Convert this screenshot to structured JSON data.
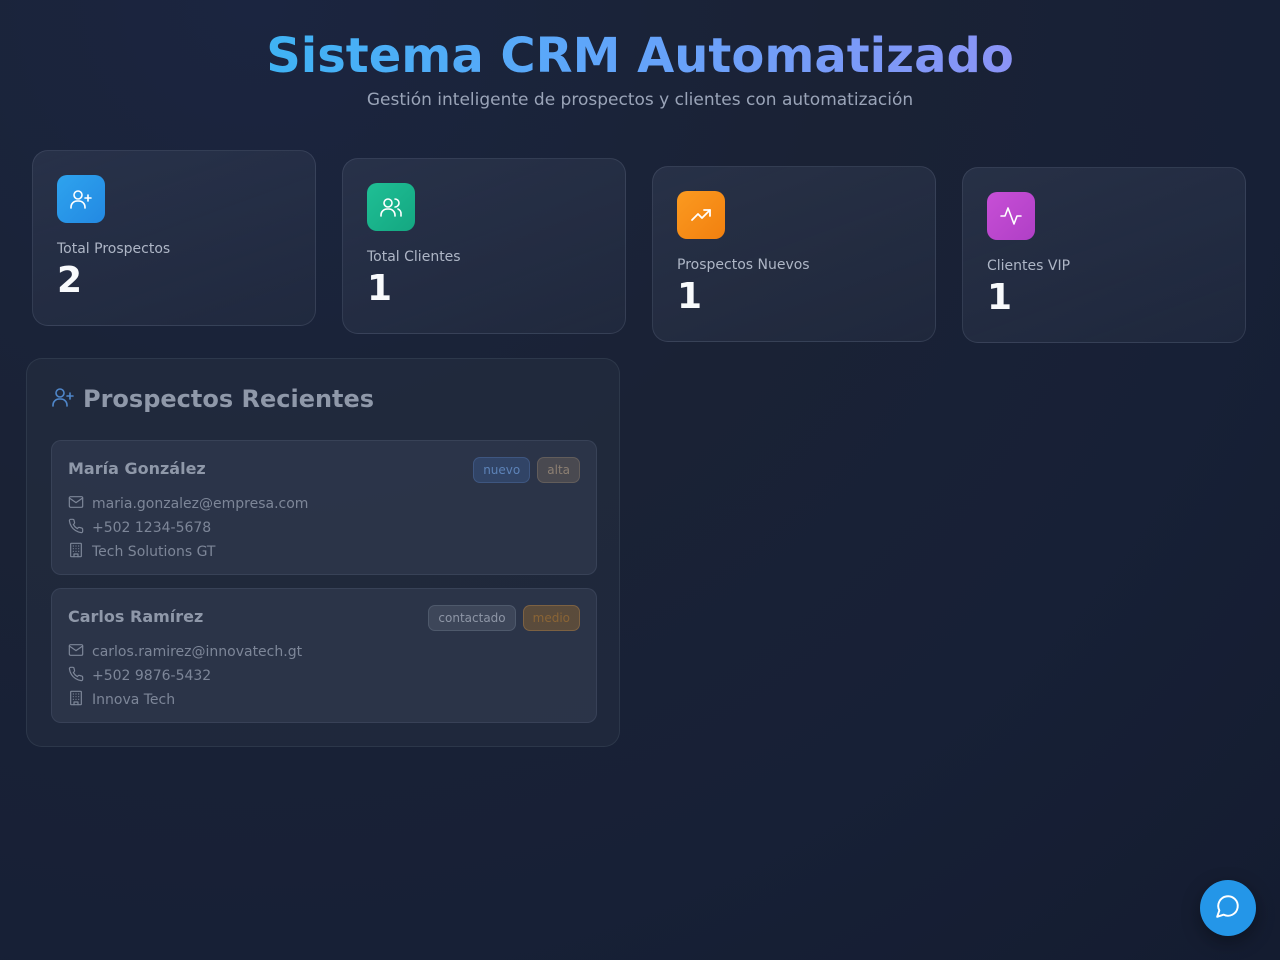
{
  "header": {
    "title": "Sistema CRM Automatizado",
    "subtitle": "Gestión inteligente de prospectos y clientes con automatización"
  },
  "stats": [
    {
      "label": "Total Prospectos",
      "value": "2",
      "icon": "user-plus-icon",
      "color": "#2b9de9"
    },
    {
      "label": "Total Clientes",
      "value": "1",
      "icon": "users-icon",
      "color": "#18b38c"
    },
    {
      "label": "Prospectos Nuevos",
      "value": "1",
      "icon": "trending-up-icon",
      "color": "#f7901e"
    },
    {
      "label": "Clientes VIP",
      "value": "1",
      "icon": "activity-icon",
      "color": "#c04bd2"
    }
  ],
  "recent": {
    "title": "Prospectos Recientes",
    "icon": "user-plus-icon",
    "items": [
      {
        "name": "María González",
        "status": "nuevo",
        "priority": "alta",
        "email": "maria.gonzalez@empresa.com",
        "phone": "+502 1234-5678",
        "company": "Tech Solutions GT"
      },
      {
        "name": "Carlos Ramírez",
        "status": "contactado",
        "priority": "medio",
        "email": "carlos.ramirez@innovatech.gt",
        "phone": "+502 9876-5432",
        "company": "Innova Tech"
      }
    ]
  },
  "chat": {
    "icon": "chat-icon"
  }
}
